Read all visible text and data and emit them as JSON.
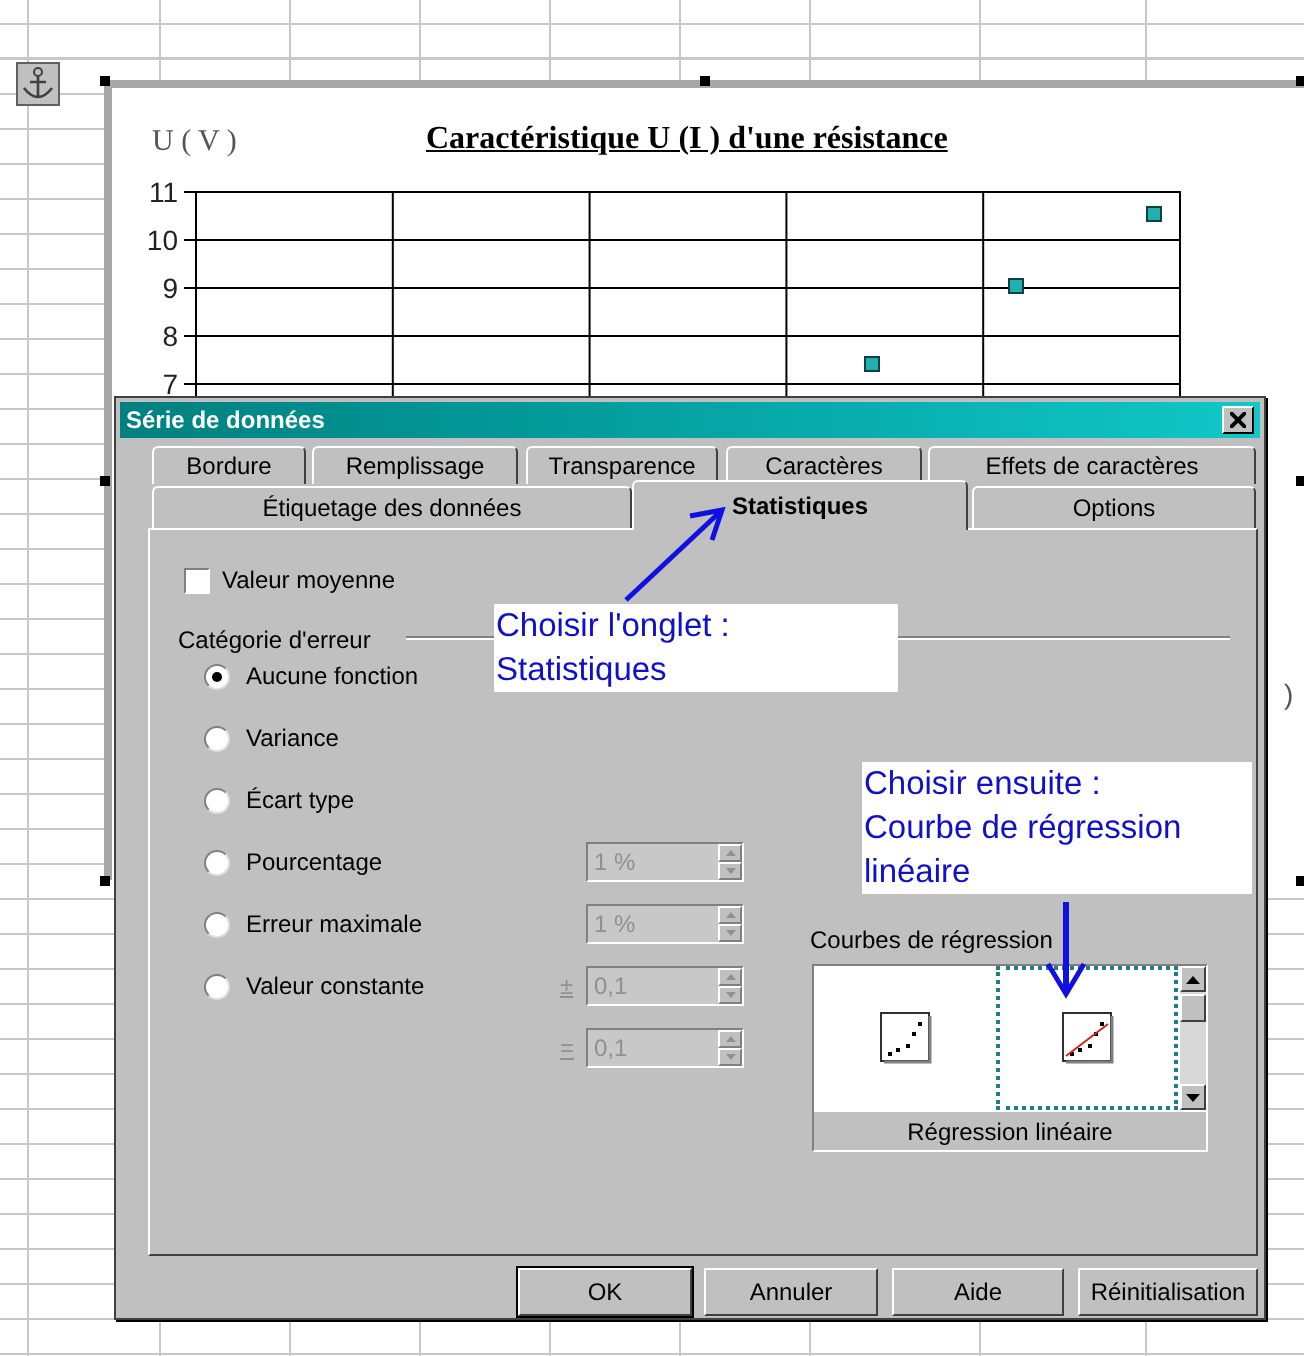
{
  "chart": {
    "title": "Caractéristique U (I ) d'une résistance",
    "ylabel": "U ( V )",
    "y_tick_labels": [
      "11",
      "10",
      "9",
      "8",
      "7"
    ],
    "side_text": ")"
  },
  "dialog": {
    "title": "Série de données",
    "tabs_row_1": [
      {
        "label": "Bordure",
        "selected": false
      },
      {
        "label": "Remplissage",
        "selected": false
      },
      {
        "label": "Transparence",
        "selected": false
      },
      {
        "label": "Caractères",
        "selected": false
      },
      {
        "label": "Effets de caractères",
        "selected": false
      }
    ],
    "tabs_row_2": [
      {
        "label": "Étiquetage des données",
        "selected": false
      },
      {
        "label": "Statistiques",
        "selected": true
      },
      {
        "label": "Options",
        "selected": false
      }
    ],
    "mean_value": {
      "label": "Valeur moyenne",
      "checked": false
    },
    "error_category": {
      "label": "Catégorie d'erreur",
      "options": [
        {
          "label": "Aucune fonction",
          "selected": true
        },
        {
          "label": "Variance",
          "selected": false
        },
        {
          "label": "Écart type",
          "selected": false
        },
        {
          "label": "Pourcentage",
          "selected": false
        },
        {
          "label": "Erreur maximale",
          "selected": false
        },
        {
          "label": "Valeur constante",
          "selected": false
        }
      ]
    },
    "fields": [
      {
        "value": "1 %",
        "disabled": true
      },
      {
        "value": "1 %",
        "disabled": true
      },
      {
        "sign": "±",
        "value": "0,1",
        "disabled": true
      },
      {
        "sign": "=",
        "value": "0,1",
        "disabled": true
      }
    ],
    "regression": {
      "label": "Courbes de régression",
      "items": [
        {
          "kind": "scatter",
          "selected": false
        },
        {
          "kind": "linear",
          "selected": true
        }
      ],
      "caption": "Régression linéaire"
    },
    "buttons": [
      {
        "label": "OK",
        "default": true
      },
      {
        "label": "Annuler",
        "default": false
      },
      {
        "label": "Aide",
        "default": false
      },
      {
        "label": "Réinitialisation",
        "default": false
      }
    ]
  },
  "annotations": [
    {
      "lines": [
        "Choisir l'onglet :",
        "Statistiques"
      ]
    },
    {
      "lines": [
        "Choisir ensuite :",
        "Courbe de régression",
        "linéaire"
      ]
    }
  ]
}
